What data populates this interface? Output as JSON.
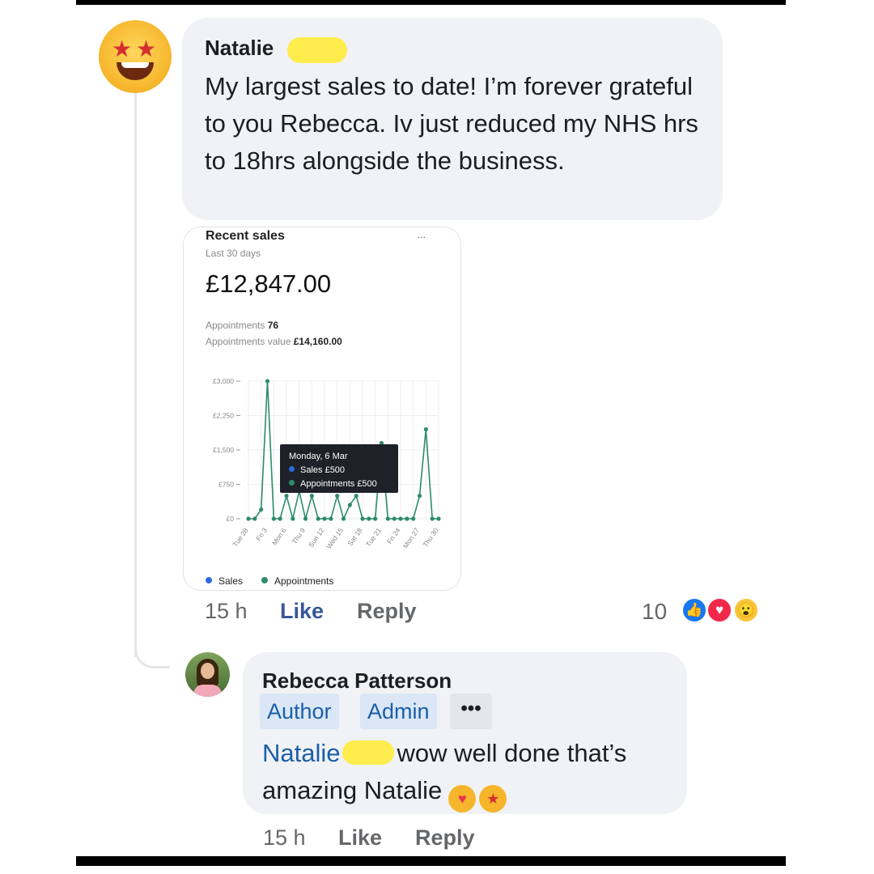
{
  "post_comment": {
    "author": "Natalie",
    "text": "My largest sales to date! I’m forever grateful to you Rebecca. Iv just reduced my NHS hrs to 18hrs alongside the business.",
    "time": "15 h",
    "like_label": "Like",
    "reply_label": "Reply",
    "reaction_count": "10",
    "reactions": [
      "like",
      "love",
      "wow"
    ]
  },
  "sales_card": {
    "title": "Recent sales",
    "subtitle": "Last 30 days",
    "more": "...",
    "total": "£12,847.00",
    "appointments_label": "Appointments",
    "appointments_value": "76",
    "appointments_value_label": "Appointments value",
    "appointments_value_amount": "£14,160.00",
    "tooltip": {
      "title": "Monday, 6 Mar",
      "sales": "Sales £500",
      "appointments": "Appointments £500"
    },
    "legend": {
      "sales": "Sales",
      "appointments": "Appointments"
    },
    "colors": {
      "sales": "#2a6be0",
      "appointments": "#2e8b6a"
    }
  },
  "chart_data": {
    "type": "line",
    "x": [
      "Tue 28",
      "Wed 1",
      "Thu 2",
      "Fri 3",
      "Sat 4",
      "Sun 5",
      "Mon 6",
      "Tue 7",
      "Wed 8",
      "Thu 9",
      "Fri 10",
      "Sat 11",
      "Sun 12",
      "Mon 13",
      "Tue 14",
      "Wed 15",
      "Thu 16",
      "Fri 17",
      "Sat 18",
      "Sun 19",
      "Mon 20",
      "Tue 21",
      "Wed 22",
      "Thu 23",
      "Fri 24",
      "Sat 25",
      "Sun 26",
      "Mon 27",
      "Tue 28",
      "Wed 29",
      "Thu 30"
    ],
    "tick_labels": [
      "Tue 28",
      "Fri 3",
      "Mon 6",
      "Thu 9",
      "Sun 12",
      "Wed 15",
      "Sat 18",
      "Tue 21",
      "Fri 24",
      "Mon 27",
      "Thu 30"
    ],
    "y_ticks": [
      "£0",
      "£750",
      "£1,500",
      "£2,250",
      "£3,000"
    ],
    "ylim": [
      0,
      3000
    ],
    "series": [
      {
        "name": "Appointments",
        "values": [
          0,
          0,
          200,
          3000,
          0,
          0,
          500,
          0,
          600,
          0,
          500,
          0,
          0,
          0,
          500,
          0,
          300,
          500,
          0,
          0,
          0,
          1650,
          0,
          0,
          0,
          0,
          0,
          500,
          1950,
          0,
          0
        ]
      }
    ],
    "grid": true,
    "legend_position": "bottom-left"
  },
  "reply_comment": {
    "author": "Rebecca Patterson",
    "badge_author": "Author",
    "badge_admin": "Admin",
    "more": "•••",
    "mention": "Natalie",
    "text_part1": "wow well done that’s",
    "text_part2": "amazing Natalie",
    "emojis": [
      "smiling-face-with-hearts",
      "star-struck"
    ],
    "time": "15 h",
    "like_label": "Like",
    "reply_label": "Reply"
  }
}
